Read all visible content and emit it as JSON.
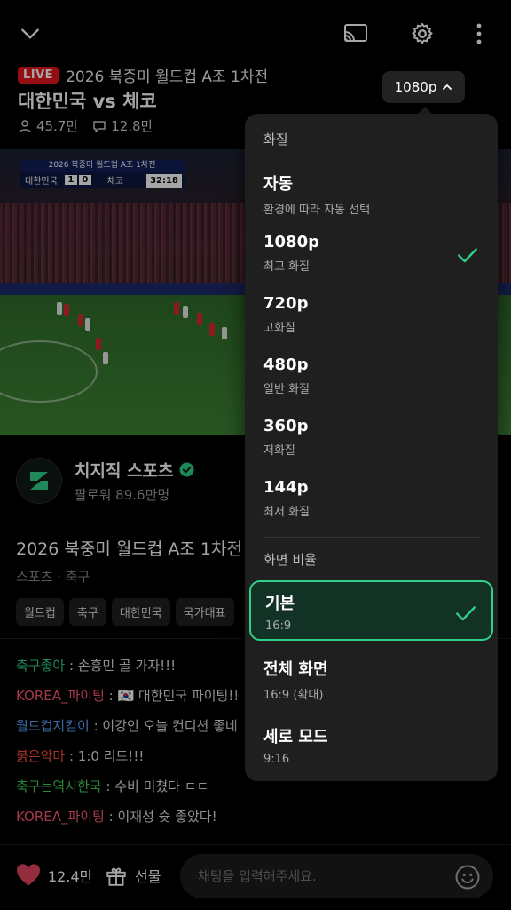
{
  "header": {
    "live_badge": "LIVE",
    "match_subtitle": "2026 북중미 월드컵 A조 1차전",
    "match_title": "대한민국 vs 체코",
    "viewers": "45.7만",
    "chats": "12.8만",
    "quality_chip": "1080p"
  },
  "video": {
    "scorebug_title": "2026 북중미 월드컵 A조 1차전",
    "team_home": "대한민국",
    "score_home": "1",
    "score_away": "0",
    "team_away": "체코",
    "clock": "32:18"
  },
  "channel": {
    "name": "치지직 스포츠",
    "followers": "팔로워 89.6만명"
  },
  "description": {
    "title": "2026 북중미 월드컵 A조 1차전",
    "category": "스포츠 · 축구",
    "tags": [
      "월드컵",
      "축구",
      "대한민국",
      "국가대표"
    ]
  },
  "chat": [
    {
      "user": "축구좋아",
      "message": " : 손흥민 골 가자!!!",
      "color": "#2fd28a"
    },
    {
      "user": "KOREA_파이팅",
      "message": " : 🇰🇷 대한민국 파이팅!!",
      "color": "#ff5a74"
    },
    {
      "user": "월드컵지킴이",
      "message": " : 이강인 오늘 컨디션 좋네",
      "color": "#5aa0ff"
    },
    {
      "user": "붉은악마",
      "message": " : 1:0 리드!!!",
      "color": "#ff5040"
    },
    {
      "user": "축구는역시한국",
      "message": " : 수비 미쳤다 ㄷㄷ",
      "color": "#3ed35a"
    },
    {
      "user": "KOREA_파이팅",
      "message": " : 이재성 슛 좋았다!",
      "color": "#ff5a74"
    }
  ],
  "bottom": {
    "likes": "12.4만",
    "gift": "선물",
    "chat_placeholder": "채팅을 입력해주세요."
  },
  "menu": {
    "quality_header": "화질",
    "quality_options": [
      {
        "title": "자동",
        "subtitle": "환경에 따라 자동 선택",
        "selected": false
      },
      {
        "title": "1080p",
        "subtitle": "최고 화질",
        "selected": true
      },
      {
        "title": "720p",
        "subtitle": "고화질",
        "selected": false
      },
      {
        "title": "480p",
        "subtitle": "일반 화질",
        "selected": false
      },
      {
        "title": "360p",
        "subtitle": "저화질",
        "selected": false
      },
      {
        "title": "144p",
        "subtitle": "최저 화질",
        "selected": false
      }
    ],
    "ratio_header": "화면 비율",
    "ratio_options": [
      {
        "title": "기본",
        "subtitle": "16:9",
        "selected": true
      },
      {
        "title": "전체 화면",
        "subtitle": "16:9 (확대)",
        "selected": false
      },
      {
        "title": "세로 모드",
        "subtitle": "9:16",
        "selected": false
      }
    ]
  },
  "colors": {
    "accent": "#2fd28a",
    "live": "#e3161e",
    "like": "#e2445c"
  }
}
